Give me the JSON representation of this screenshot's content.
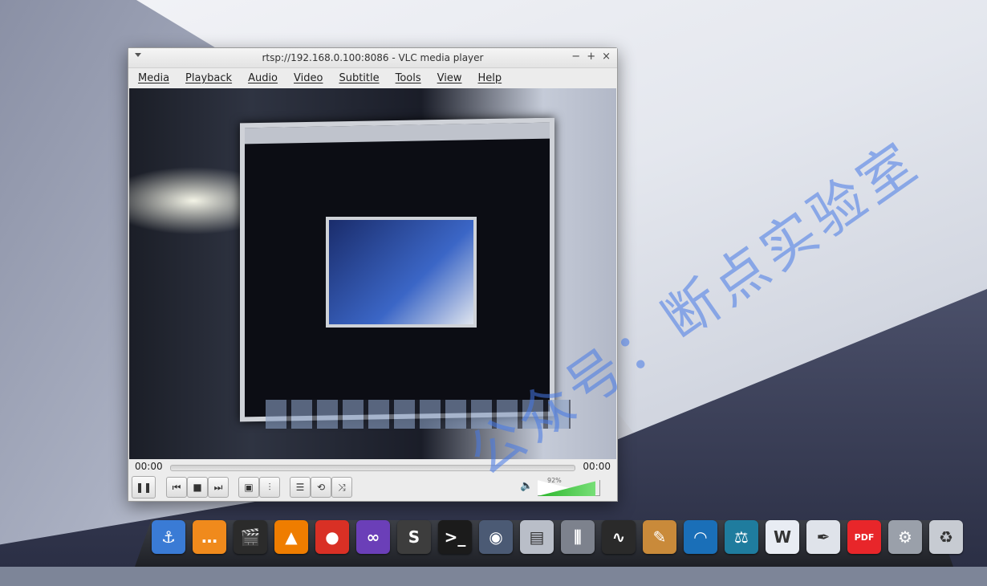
{
  "window": {
    "title": "rtsp://192.168.0.100:8086 - VLC media player",
    "controls": {
      "minimize": "−",
      "maximize": "+",
      "close": "×"
    }
  },
  "menu": [
    "Media",
    "Playback",
    "Audio",
    "Video",
    "Subtitle",
    "Tools",
    "View",
    "Help"
  ],
  "player": {
    "elapsed": "00:00",
    "remaining": "00:00",
    "volume_percent": 92,
    "volume_label": "92%"
  },
  "buttons": {
    "pause": "❚❚",
    "prev": "⏮",
    "stop": "■",
    "next": "⏭",
    "fullscreen": "▣",
    "extended": "⫶",
    "playlist": "☰",
    "loop": "⟲",
    "random": "⤨",
    "volume_icon": "🔈"
  },
  "watermark": "公众号：断点实验室",
  "dock": [
    {
      "name": "anchor-icon",
      "glyph": "⚓",
      "color": "#3a7bd5"
    },
    {
      "name": "chat-app-icon",
      "glyph": "…",
      "color": "#f08a1c"
    },
    {
      "name": "clapper-icon",
      "glyph": "🎬",
      "color": "#2b2b2b"
    },
    {
      "name": "vlc-icon",
      "glyph": "▲",
      "color": "#ef7d00"
    },
    {
      "name": "chrome-icon",
      "glyph": "●",
      "color": "#d93025"
    },
    {
      "name": "infinity-icon",
      "glyph": "∞",
      "color": "#6b3fb8"
    },
    {
      "name": "sublime-icon",
      "glyph": "S",
      "color": "#3d3d3d"
    },
    {
      "name": "terminal-icon",
      "glyph": ">_",
      "color": "#1b1b1b"
    },
    {
      "name": "camera-icon",
      "glyph": "◉",
      "color": "#4b5a74"
    },
    {
      "name": "file-cabinet-icon",
      "glyph": "▤",
      "color": "#b9bec8"
    },
    {
      "name": "mixer-icon",
      "glyph": "⫼",
      "color": "#7d828d"
    },
    {
      "name": "system-monitor-icon",
      "glyph": "∿",
      "color": "#2a2a2a"
    },
    {
      "name": "paint-icon",
      "glyph": "✎",
      "color": "#c98a3a"
    },
    {
      "name": "wireshark-icon",
      "glyph": "◠",
      "color": "#1a6fb8"
    },
    {
      "name": "scale-icon",
      "glyph": "⚖",
      "color": "#1f7c9e"
    },
    {
      "name": "word-doc-icon",
      "glyph": "W",
      "color": "#e8ecf3"
    },
    {
      "name": "inkscape-icon",
      "glyph": "✒",
      "color": "#dfe3ea"
    },
    {
      "name": "pdf-icon",
      "glyph": "PDF",
      "color": "#e8262a"
    },
    {
      "name": "settings-icon",
      "glyph": "⚙",
      "color": "#9aa0aa"
    },
    {
      "name": "trash-icon",
      "glyph": "♻",
      "color": "#c7cbd2"
    }
  ]
}
